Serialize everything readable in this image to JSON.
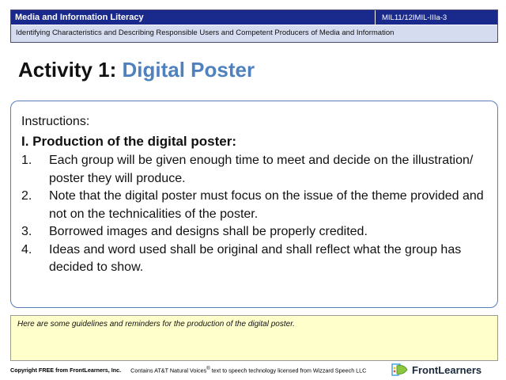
{
  "header": {
    "title": "Media and Information Literacy",
    "code": "MIL11/12IMIL-IIIa-3",
    "subtitle": "Identifying Characteristics and Describing Responsible Users and Competent Producers of Media and Information"
  },
  "activity": {
    "prefix": "Activity 1: ",
    "name": "Digital Poster"
  },
  "instructions": {
    "label": "Instructions:",
    "heading": "I. Production  of the digital poster:",
    "items": [
      {
        "num": "1.",
        "text": "Each group will be given enough time to meet and  decide on the illustration/ poster they will produce."
      },
      {
        "num": "2.",
        "text": "Note that the digital poster must focus on the issue of the theme provided and not on the technicalities of the poster."
      },
      {
        "num": "3.",
        "text": "Borrowed images and designs shall be properly credited."
      },
      {
        "num": "4.",
        "text": "Ideas and word used shall be original and shall reflect what the group has decided to show."
      }
    ]
  },
  "guidelines": {
    "text": "Here are some guidelines and reminders for the production of the digital poster."
  },
  "footer": {
    "copyright": "Copyright FREE from FrontLearners, Inc.",
    "voices_pre": "Contains AT&T Natural Voices",
    "voices_sup": "®",
    "voices_post": " text to speech technology licensed from Wizzard Speech LLC",
    "brand": "FrontLearners"
  },
  "colors": {
    "header_bg": "#1a2a8c",
    "subheader_bg": "#d6dcef",
    "title_accent": "#4f81bd",
    "box_border": "#5b7db8",
    "guidelines_bg": "#ffffcc"
  }
}
